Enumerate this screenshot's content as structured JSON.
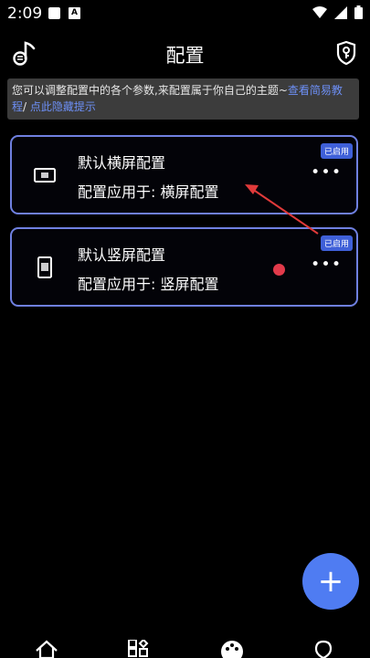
{
  "status": {
    "time": "2:09"
  },
  "header": {
    "title": "配置"
  },
  "notice": {
    "text": "您可以调整配置中的各个参数,来配置属于你自己的主题~",
    "link1": "查看简易教程",
    "sep": "/",
    "link2": "点此隐藏提示"
  },
  "cards": [
    {
      "title": "默认横屏配置",
      "subtitle": "配置应用于: 横屏配置",
      "badge": "已启用",
      "icon": "landscape-phone-icon"
    },
    {
      "title": "默认竖屏配置",
      "subtitle": "配置应用于: 竖屏配置",
      "badge": "已启用",
      "icon": "portrait-phone-icon"
    }
  ],
  "fab": {
    "label": "+"
  },
  "colors": {
    "accent": "#4f7cf2",
    "card_border": "#6f80e0",
    "badge": "#3f60d8",
    "link": "#6d8ff5"
  }
}
